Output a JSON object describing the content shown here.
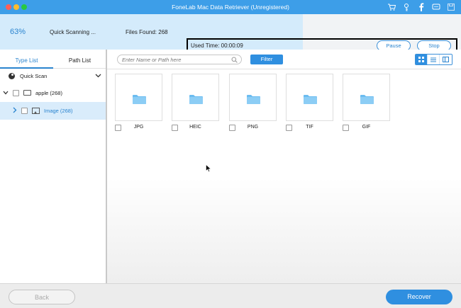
{
  "window": {
    "title": "FoneLab Mac Data Retriever (Unregistered)"
  },
  "toolbar_icons": [
    "cart-icon",
    "key-icon",
    "facebook-icon",
    "chat-icon",
    "save-icon"
  ],
  "scan": {
    "progress": 0.63,
    "percent_label": "63%",
    "status": "Quick Scanning ...",
    "files_found": "Files Found: 268",
    "used_time": "Used Time: 00:00:09",
    "pause_label": "Pause",
    "stop_label": "Stop"
  },
  "sidebar": {
    "tabs": [
      {
        "label": "Type List",
        "active": true
      },
      {
        "label": "Path List",
        "active": false
      }
    ],
    "quick_scan_label": "Quick Scan",
    "tree": [
      {
        "label": "apple (268)",
        "expanded": true
      },
      {
        "label": "Image (268)",
        "selected": true
      }
    ]
  },
  "main": {
    "search_placeholder": "Enter Name or Path here",
    "filter_label": "Filter",
    "views": [
      "grid-view-icon",
      "list-view-icon",
      "detail-view-icon"
    ],
    "folders": [
      {
        "label": "JPG"
      },
      {
        "label": "HEIC"
      },
      {
        "label": "PNG"
      },
      {
        "label": "TIF"
      },
      {
        "label": "GIF"
      }
    ]
  },
  "footer": {
    "back_label": "Back",
    "recover_label": "Recover"
  },
  "colors": {
    "accent": "#2f8fe0",
    "titlebar": "#3d9ee8",
    "progress_fill": "#d4ebfb",
    "folder": "#6bbcf0"
  }
}
